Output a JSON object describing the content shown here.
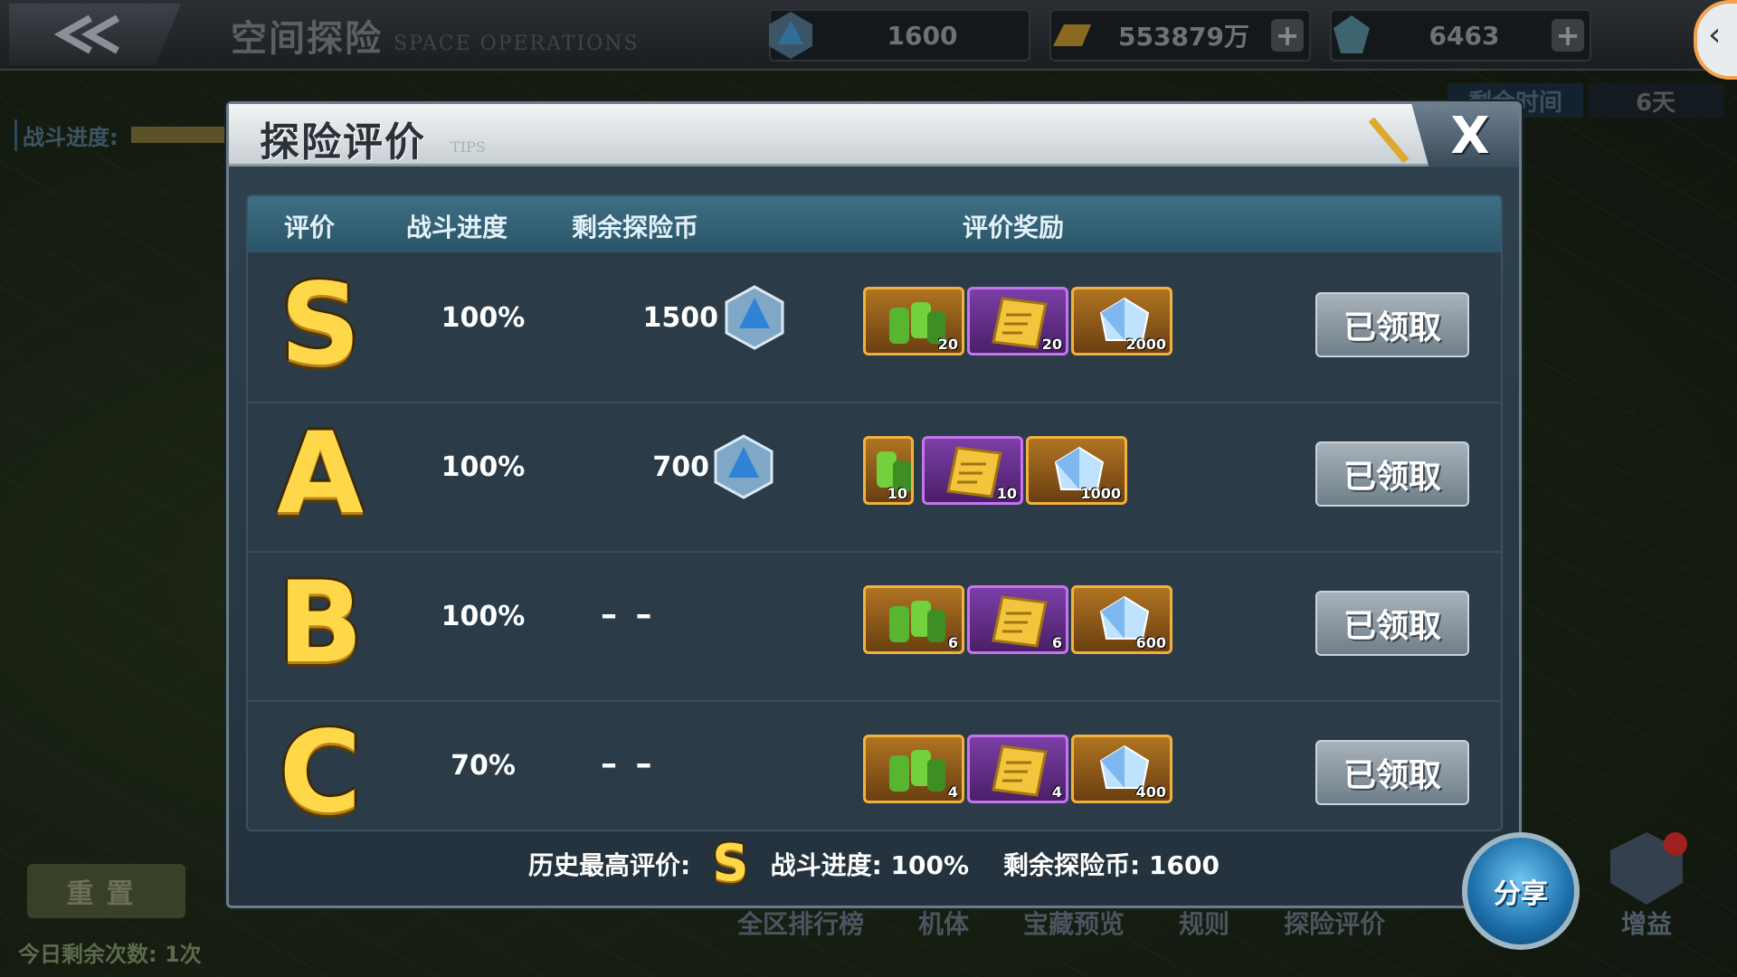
{
  "topbar": {
    "title": "空间探险",
    "subtitle": "SPACE OPERATIONS",
    "resources": [
      {
        "icon": "explore-coin-icon",
        "value": "1600",
        "has_plus": false
      },
      {
        "icon": "gold-bar-icon",
        "value": "553879万",
        "has_plus": true
      },
      {
        "icon": "crystal-icon",
        "value": "6463",
        "has_plus": true
      }
    ]
  },
  "background": {
    "remain_time_label": "剩余时间",
    "remain_days": "6天",
    "battle_progress_label": "战斗进度:",
    "reset_label": "重置",
    "today_left": "今日剩余次数: 1次",
    "nav": [
      "全区排行榜",
      "机体",
      "宝藏预览",
      "规则",
      "探险评价"
    ],
    "boost_label": "增益"
  },
  "modal": {
    "title": "探险评价",
    "tips": "TIPS",
    "close_label": "X",
    "headers": {
      "grade": "评价",
      "progress": "战斗进度",
      "coins": "剩余探险币",
      "rewards": "评价奖励"
    },
    "rows": [
      {
        "grade": "S",
        "progress": "100%",
        "coins": "1500",
        "rewards": [
          "20",
          "20",
          "2000"
        ],
        "claim": "已领取"
      },
      {
        "grade": "A",
        "progress": "100%",
        "coins": "700",
        "rewards": [
          "10",
          "10",
          "1000"
        ],
        "claim": "已领取"
      },
      {
        "grade": "B",
        "progress": "100%",
        "coins": "– –",
        "rewards": [
          "6",
          "6",
          "600"
        ],
        "claim": "已领取"
      },
      {
        "grade": "C",
        "progress": "70%",
        "coins": "– –",
        "rewards": [
          "4",
          "4",
          "400"
        ],
        "claim": "已领取"
      }
    ],
    "footer": {
      "best_label": "历史最高评价:",
      "best_grade": "S",
      "progress_label": "战斗进度: 100%",
      "coins_label": "剩余探险币: 1600"
    }
  },
  "share_label": "分享",
  "colors": {
    "gold": "#ffd84a",
    "header": "#3e6f85",
    "claim_btn": "#8f9ca5"
  }
}
